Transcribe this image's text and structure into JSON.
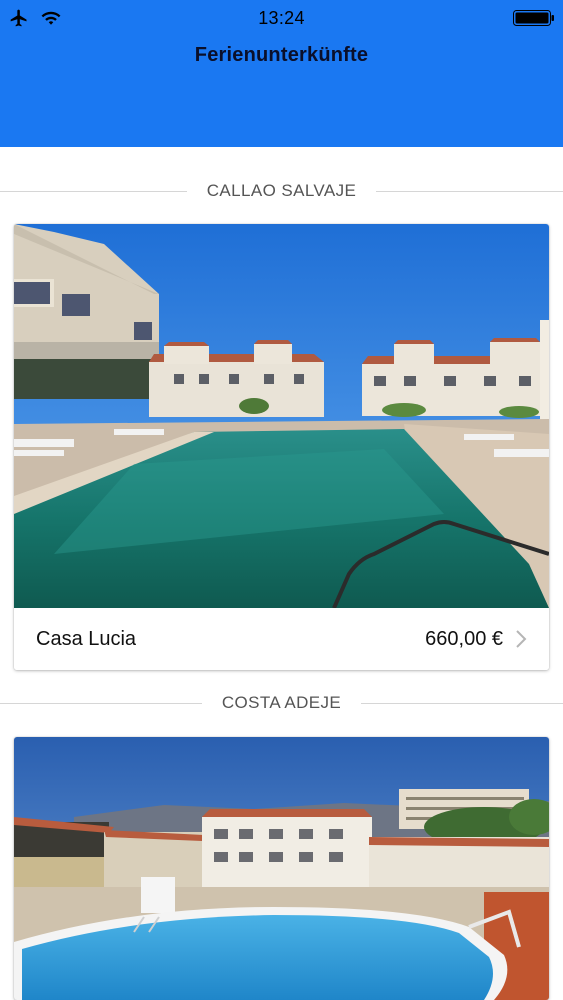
{
  "status_bar": {
    "time": "13:24",
    "icons": [
      "airplane-icon",
      "wifi-icon",
      "battery-icon"
    ]
  },
  "nav": {
    "title": "Ferienunterkünfte",
    "background_color": "#1a78f2"
  },
  "sections": [
    {
      "header": "CALLAO SALVAJE",
      "listing": {
        "name": "Casa Lucia",
        "price": "660,00 €"
      }
    },
    {
      "header": "COSTA ADEJE",
      "listing": {
        "name": "",
        "price": ""
      }
    }
  ]
}
